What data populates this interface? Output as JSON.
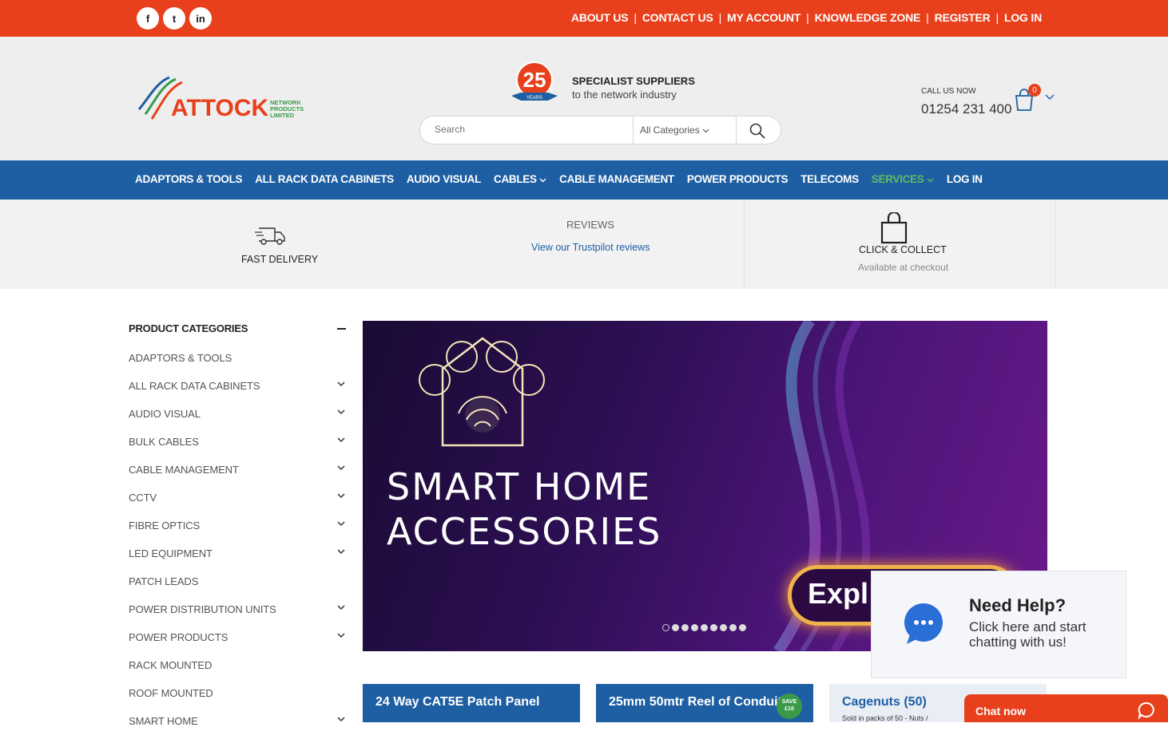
{
  "topbar": {
    "social": [
      {
        "name": "facebook",
        "glyph": "f"
      },
      {
        "name": "twitter",
        "glyph": "t"
      },
      {
        "name": "linkedin",
        "glyph": "in"
      }
    ],
    "links": [
      "ABOUT US",
      "CONTACT US",
      "MY ACCOUNT",
      "KNOWLEDGE ZONE",
      "REGISTER",
      "LOG IN"
    ],
    "separator": "|"
  },
  "header": {
    "logo_text": "ATTOCK",
    "logo_sub": [
      "NETWORK",
      "PRODUCTS",
      "LIMITED"
    ],
    "badge_number": "25",
    "badge_text": "YEARS",
    "spec_title": "SPECIALIST SUPPLIERS",
    "spec_sub": "to the network industry",
    "search_placeholder": "Search",
    "search_category": "All Categories",
    "call_label": "CALL US NOW",
    "phone": "01254 231 400",
    "cart_count": "0"
  },
  "nav": {
    "items": [
      "ADAPTORS & TOOLS",
      "ALL RACK DATA CABINETS",
      "AUDIO VISUAL",
      "CABLES",
      "CABLE MANAGEMENT",
      "POWER PRODUCTS",
      "TELECOMS",
      "SERVICES",
      "LOG IN"
    ]
  },
  "features": {
    "delivery": "FAST DELIVERY",
    "reviews_title": "REVIEWS",
    "reviews_link": "View our Trustpilot reviews",
    "collect_title": "CLICK & COLLECT",
    "collect_sub": "Available at checkout"
  },
  "sidebar": {
    "title": "PRODUCT CATEGORIES",
    "items": [
      {
        "label": "ADAPTORS & TOOLS",
        "expandable": false
      },
      {
        "label": "ALL RACK DATA CABINETS",
        "expandable": true
      },
      {
        "label": "AUDIO VISUAL",
        "expandable": true
      },
      {
        "label": "BULK CABLES",
        "expandable": true
      },
      {
        "label": "CABLE MANAGEMENT",
        "expandable": true
      },
      {
        "label": "CCTV",
        "expandable": true
      },
      {
        "label": "FIBRE OPTICS",
        "expandable": true
      },
      {
        "label": "LED EQUIPMENT",
        "expandable": true
      },
      {
        "label": "PATCH LEADS",
        "expandable": false
      },
      {
        "label": "POWER DISTRIBUTION UNITS",
        "expandable": true
      },
      {
        "label": "POWER PRODUCTS",
        "expandable": true
      },
      {
        "label": "RACK MOUNTED",
        "expandable": false
      },
      {
        "label": "ROOF MOUNTED",
        "expandable": false
      },
      {
        "label": "SMART HOME",
        "expandable": true
      }
    ]
  },
  "banner": {
    "title_line1": "SMART HOME",
    "title_line2": "ACCESSORIES",
    "cta": "Expl",
    "slide_count": 9,
    "active_slide": 0
  },
  "products": [
    {
      "title": "24 Way CAT5E Patch Panel",
      "sub": ""
    },
    {
      "title": "25mm 50mtr Reel of Conduit",
      "sub": ""
    },
    {
      "title": "Cagenuts (50)",
      "sub": "Sold in packs of 50 - Nuts /"
    }
  ],
  "save_badge": [
    "SAVE",
    "£10"
  ],
  "help": {
    "title": "Need Help?",
    "text": "Click here and start chatting with us!",
    "chat_now": "Chat now"
  },
  "colors": {
    "accent": "#e8401c",
    "nav": "#1e5fa3",
    "services_active": "#5dbb63"
  }
}
